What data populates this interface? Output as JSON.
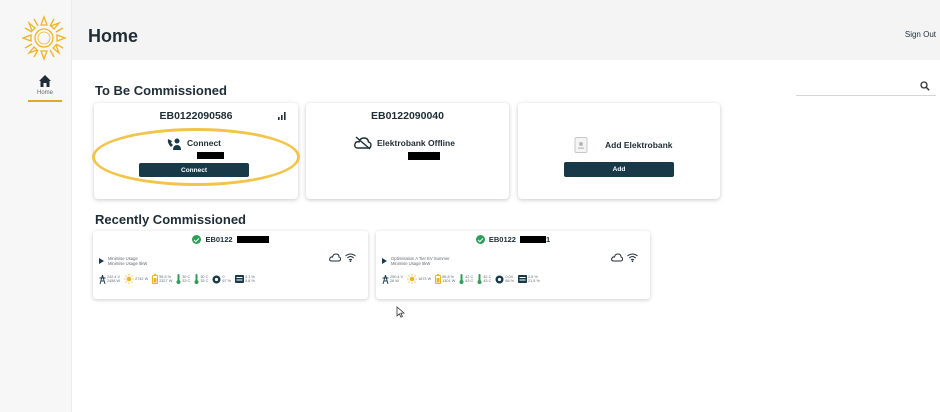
{
  "header": {
    "title": "Home",
    "sign_out": "Sign Out"
  },
  "sidebar": {
    "home_label": "Home",
    "accent": "#e4a724"
  },
  "search": {
    "placeholder": ""
  },
  "to_be_commissioned": {
    "title": "To Be Commissioned",
    "cards": [
      {
        "id": "EB0122090586",
        "status": "Connect",
        "button": "Connect",
        "signal_icon": "signal-bars-icon",
        "status_icon": "phone-connect-icon"
      },
      {
        "id": "EB0122090040",
        "status": "Elektrobank Offline",
        "status_icon": "cloud-offline-icon"
      },
      {
        "status": "Add Elektrobank",
        "button": "Add",
        "status_icon": "device-icon"
      }
    ]
  },
  "recently_commissioned": {
    "title": "Recently Commissioned",
    "cards": [
      {
        "id": "EB0122",
        "mode_1": "Minimise Usage",
        "mode_2": "Minimise Usage 5kW",
        "metrics": [
          "242.4 V\n2458 W",
          "2742 W",
          "95.5 %\n2327 W",
          "30 C\n33 C",
          "30 C\n33 C",
          "0\n67 %",
          "3.1 %\n3.8 %"
        ]
      },
      {
        "id": "EB0122",
        "id_suffix": "1",
        "mode_1": "Optimisation A Tier EV Summer",
        "mode_2": "Minimise Usage 5kW",
        "metrics": [
          "250.4 V\n28 W",
          "1673 W",
          "89.8 %\n1301 W",
          "42 C\n43 C",
          "42 C\n43 C",
          "0.04\n66 %",
          "2.6 %\n21.5 %"
        ]
      }
    ]
  },
  "colors": {
    "primary_dark": "#173948",
    "success": "#2e9e57",
    "highlight": "#f2c44a",
    "sun": "#f0b323"
  }
}
